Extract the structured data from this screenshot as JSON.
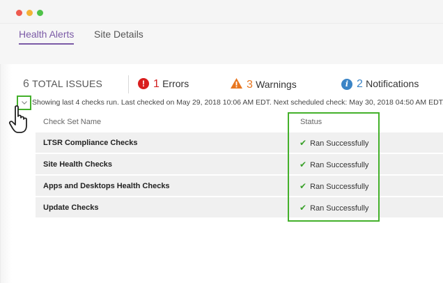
{
  "window": {
    "controls": [
      "close",
      "minimize",
      "maximize"
    ]
  },
  "tabs": [
    {
      "label": "Health Alerts",
      "active": true
    },
    {
      "label": "Site Details",
      "active": false
    }
  ],
  "summary": {
    "total_count": "6",
    "total_label": "TOTAL ISSUES",
    "errors_count": "1",
    "errors_label": "Errors",
    "warnings_count": "3",
    "warnings_label": "Warnings",
    "notifications_count": "2",
    "notifications_label": "Notifications",
    "error_icon": "error-icon",
    "warning_icon": "warning-icon",
    "info_icon": "info-icon"
  },
  "checks_info": "Showing last 4 checks run. Last checked on May 29, 2018 10:06 AM EDT. Next scheduled check: May 30, 2018 04:50 AM EDT.",
  "table": {
    "headers": [
      "Check Set Name",
      "Status"
    ],
    "rows": [
      {
        "name": "LTSR Compliance Checks",
        "status": "Ran Successfully"
      },
      {
        "name": "Site Health Checks",
        "status": "Ran Successfully"
      },
      {
        "name": "Apps and Desktops Health Checks",
        "status": "Ran Successfully"
      },
      {
        "name": "Update Checks",
        "status": "Ran Successfully"
      }
    ]
  },
  "colors": {
    "accent": "#7b5aa6",
    "error": "#d22020",
    "warning": "#e8761f",
    "info": "#3a84c6",
    "success": "#3aa12a",
    "highlight": "#43b02a"
  }
}
